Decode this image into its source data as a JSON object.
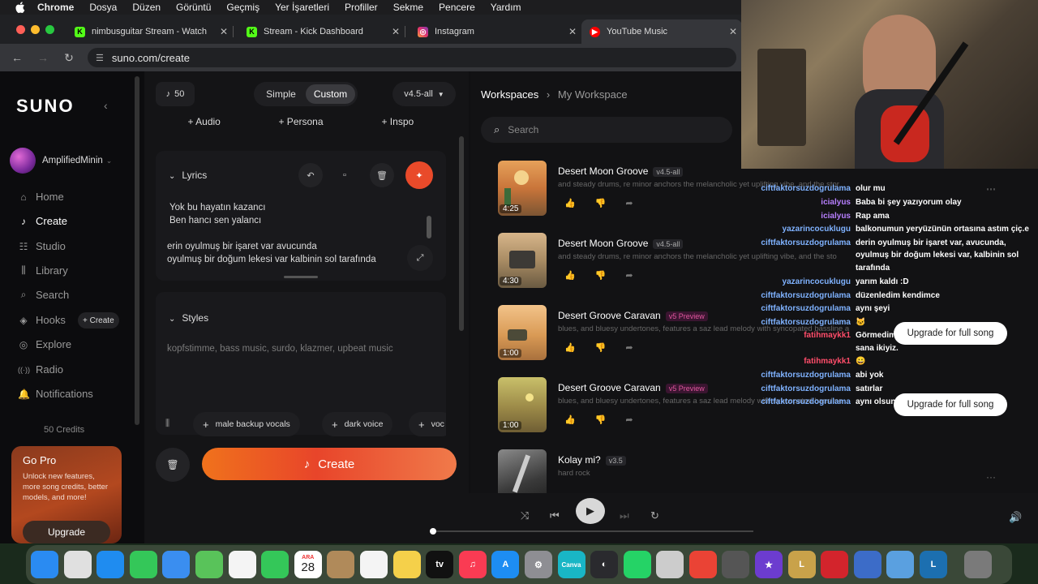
{
  "menubar": {
    "items": [
      "Chrome",
      "Dosya",
      "Düzen",
      "Görüntü",
      "Geçmiş",
      "Yer İşaretleri",
      "Profiller",
      "Sekme",
      "Pencere",
      "Yardım"
    ]
  },
  "tabs": [
    {
      "title": "nimbusguitar Stream - Watch",
      "favicon": "K",
      "color": "#53fc18"
    },
    {
      "title": "Stream - Kick Dashboard",
      "favicon": "K",
      "color": "#53fc18"
    },
    {
      "title": "Instagram",
      "favicon": "◎",
      "color": "#e1306c"
    },
    {
      "title": "YouTube Music",
      "favicon": "▶",
      "color": "#ff0000"
    }
  ],
  "address": {
    "url": "suno.com/create"
  },
  "sidebar": {
    "logo": "SUNO",
    "username": "AmplifiedMinin",
    "items": [
      {
        "label": "Home",
        "icon": "home-icon",
        "glyph": "⌂"
      },
      {
        "label": "Create",
        "icon": "create-icon",
        "glyph": "♪"
      },
      {
        "label": "Studio",
        "icon": "studio-icon",
        "glyph": "☷"
      },
      {
        "label": "Library",
        "icon": "library-icon",
        "glyph": "⫼"
      },
      {
        "label": "Search",
        "icon": "search-icon",
        "glyph": "⌕"
      },
      {
        "label": "Hooks",
        "icon": "hooks-icon",
        "glyph": "◈"
      },
      {
        "label": "Explore",
        "icon": "explore-icon",
        "glyph": "◎"
      },
      {
        "label": "Radio",
        "icon": "radio-icon",
        "glyph": "((·))"
      },
      {
        "label": "Notifications",
        "icon": "bell-icon",
        "glyph": "🔔"
      }
    ],
    "hooks_create": "+ Create",
    "credits": "50 Credits",
    "gopro": {
      "title": "Go Pro",
      "desc": "Unlock new features, more song credits, better models, and more!",
      "button": "Upgrade"
    }
  },
  "create": {
    "credits": "50",
    "mode_simple": "Simple",
    "mode_custom": "Custom",
    "version": "v4.5-all",
    "add_audio": "+ Audio",
    "add_persona": "+ Persona",
    "add_inspo": "+ Inspo",
    "lyrics_header": "Lyrics",
    "lyrics": [
      "Yok bu hayatın kazancı",
      "Ben hancı sen yalancı",
      "",
      "erin oyulmuş bir işaret var avucunda",
      "oyulmuş bir doğum lekesi var  kalbinin sol tarafında"
    ],
    "styles_header": "Styles",
    "styles_placeholder": "kopfstimme, bass music, surdo, klazmer, upbeat music",
    "tags": [
      "male backup vocals",
      "dark voice",
      "voc"
    ],
    "create_button": "Create"
  },
  "workspace": {
    "crumb_root": "Workspaces",
    "crumb_current": "My Workspace",
    "search_placeholder": "Search",
    "songs": [
      {
        "title": "Desert Moon Groove",
        "badge": "v4.5-all",
        "desc": "and steady drums, re minor anchors the melancholic yet uplifting vibe, and the stor",
        "duration": "4:25"
      },
      {
        "title": "Desert Moon Groove",
        "badge": "v4.5-all",
        "desc": "and steady drums, re minor anchors the melancholic yet uplifting vibe, and the sto",
        "duration": "4:30"
      },
      {
        "title": "Desert Groove Caravan",
        "badge": "v5 Preview",
        "desc": "blues, and bluesy undertones, features a saz lead melody with syncopated bassline a",
        "duration": "1:00"
      },
      {
        "title": "Desert Groove Caravan",
        "badge": "v5 Preview",
        "desc": "blues, and bluesy undertones, features a saz lead melody with syncopated bassline",
        "duration": "1:00"
      },
      {
        "title": "Kolay mi?",
        "badge": "v3.5",
        "desc": "hard rock",
        "duration": ""
      }
    ]
  },
  "chat": {
    "messages": [
      {
        "user": "ciftfaktorsuzdogrulama",
        "color": "#7fb2ff",
        "text": "olur mu"
      },
      {
        "user": "icialyus",
        "color": "#b77fff",
        "text": "Baba bi şey yazıyorum olay"
      },
      {
        "user": "icialyus",
        "color": "#b77fff",
        "text": "Rap ama"
      },
      {
        "user": "yazarincocuklugu",
        "color": "#7fb2ff",
        "text": "balkonumun yeryüzünün ortasına astım çiç.e"
      },
      {
        "user": "ciftfaktorsuzdogrulama",
        "color": "#7fb2ff",
        "text": "derin oyulmuş bir işaret var, avucunda,"
      },
      {
        "user": "",
        "color": "#7fb2ff",
        "text": "oyulmuş bir doğum lekesi var, kalbinin sol"
      },
      {
        "user": "",
        "color": "#7fb2ff",
        "text": "tarafında"
      },
      {
        "user": "yazarincocuklugu",
        "color": "#7fb2ff",
        "text": "yarım kaldı :D"
      },
      {
        "user": "ciftfaktorsuzdogrulama",
        "color": "#7fb2ff",
        "text": "düzenledim kendimce"
      },
      {
        "user": "ciftfaktorsuzdogrulama",
        "color": "#7fb2ff",
        "text": "aynı şeyi"
      },
      {
        "user": "ciftfaktorsuzdogrulama",
        "color": "#7fb2ff",
        "text": "🐱"
      },
      {
        "user": "fatihmaykk1",
        "color": "#ff4d6a",
        "text": "Görmedim"
      },
      {
        "user": "",
        "color": "#ff4d6a",
        "text": "sana ikiyiz."
      },
      {
        "user": "fatihmaykk1",
        "color": "#ff4d6a",
        "text": "😀"
      },
      {
        "user": "ciftfaktorsuzdogrulama",
        "color": "#7fb2ff",
        "text": "abi yok"
      },
      {
        "user": "ciftfaktorsuzdogrulama",
        "color": "#7fb2ff",
        "text": "satırlar"
      },
      {
        "user": "ciftfaktorsuzdogrulama",
        "color": "#7fb2ff",
        "text": "aynı olsun"
      }
    ],
    "upgrade_1": "Upgrade for full song",
    "upgrade_2": "Upgrade for full song"
  },
  "dock": {
    "calendar_month": "ARA",
    "calendar_day": "28",
    "apps": [
      {
        "name": "finder-icon",
        "color": "#2a8bf2",
        "label": ""
      },
      {
        "name": "launchpad-icon",
        "color": "#e0e0e0",
        "label": ""
      },
      {
        "name": "safari-icon",
        "color": "#1f8cf0",
        "label": ""
      },
      {
        "name": "messages-icon",
        "color": "#34c759",
        "label": ""
      },
      {
        "name": "mail-icon",
        "color": "#3a8ef0",
        "label": ""
      },
      {
        "name": "maps-icon",
        "color": "#59c35a",
        "label": ""
      },
      {
        "name": "photos-icon",
        "color": "#f4f4f4",
        "label": ""
      },
      {
        "name": "facetime-icon",
        "color": "#34c759",
        "label": ""
      },
      {
        "name": "calendar-icon",
        "color": "#ffffff",
        "label": ""
      },
      {
        "name": "contacts-icon",
        "color": "#b08a5a",
        "label": ""
      },
      {
        "name": "reminders-icon",
        "color": "#f4f4f4",
        "label": ""
      },
      {
        "name": "notes-icon",
        "color": "#f5d04a",
        "label": ""
      },
      {
        "name": "appletv-icon",
        "color": "#111111",
        "label": "tv"
      },
      {
        "name": "music-icon",
        "color": "#fa3b53",
        "label": "♫"
      },
      {
        "name": "appstore-icon",
        "color": "#1d8df3",
        "label": "A"
      },
      {
        "name": "settings-icon",
        "color": "#8e8e93",
        "label": "⚙"
      },
      {
        "name": "canva-icon",
        "color": "#19b6c5",
        "label": "Canva"
      },
      {
        "name": "obs-icon",
        "color": "#2a2a2e",
        "label": "◐"
      },
      {
        "name": "whatsapp-icon",
        "color": "#25d366",
        "label": ""
      },
      {
        "name": "disk-utility-icon",
        "color": "#cccccc",
        "label": ""
      },
      {
        "name": "chrome-icon",
        "color": "#ea4335",
        "label": ""
      },
      {
        "name": "calculator-icon",
        "color": "#555555",
        "label": ""
      },
      {
        "name": "star-app-icon",
        "color": "#6c3ccf",
        "label": "★"
      },
      {
        "name": "league-icon",
        "color": "#c9a24a",
        "label": "L"
      },
      {
        "name": "riot-icon",
        "color": "#d3242c",
        "label": ""
      },
      {
        "name": "eye-app-icon",
        "color": "#3c6cc8",
        "label": ""
      },
      {
        "name": "preview-icon",
        "color": "#5aa0e0",
        "label": ""
      },
      {
        "name": "league-client-icon",
        "color": "#1c6fb0",
        "label": "L"
      },
      {
        "name": "trash-icon",
        "color": "#7a7a7a",
        "label": ""
      }
    ]
  }
}
